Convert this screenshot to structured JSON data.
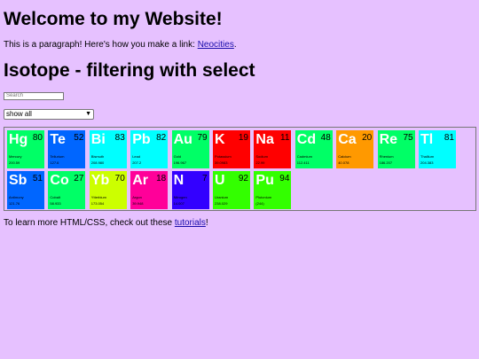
{
  "title": "Welcome to my Website!",
  "paragraph1": {
    "before": "This is a paragraph! Here's how you make a link: ",
    "link": "Neocities",
    "after": "."
  },
  "title2": "Isotope - filtering with select",
  "search": {
    "placeholder": "Search"
  },
  "filter": {
    "selected": "show all"
  },
  "elements": [
    {
      "symbol": "Hg",
      "number": "80",
      "name": "Mercury",
      "weight": "200.59",
      "color": "#00ff66"
    },
    {
      "symbol": "Te",
      "number": "52",
      "name": "Tellurium",
      "weight": "127.6",
      "color": "#0066ff"
    },
    {
      "symbol": "Bi",
      "number": "83",
      "name": "Bismuth",
      "weight": "208.980",
      "color": "#00ffff"
    },
    {
      "symbol": "Pb",
      "number": "82",
      "name": "Lead",
      "weight": "207.2",
      "color": "#00ffff"
    },
    {
      "symbol": "Au",
      "number": "79",
      "name": "Gold",
      "weight": "196.967",
      "color": "#00ff66"
    },
    {
      "symbol": "K",
      "number": "19",
      "name": "Potassium",
      "weight": "39.0983",
      "color": "#ff0000"
    },
    {
      "symbol": "Na",
      "number": "11",
      "name": "Sodium",
      "weight": "22.99",
      "color": "#ff0000"
    },
    {
      "symbol": "Cd",
      "number": "48",
      "name": "Cadmium",
      "weight": "112.411",
      "color": "#00ff66"
    },
    {
      "symbol": "Ca",
      "number": "20",
      "name": "Calcium",
      "weight": "40.078",
      "color": "#ff9900"
    },
    {
      "symbol": "Re",
      "number": "75",
      "name": "Rhenium",
      "weight": "186.207",
      "color": "#00ff66"
    },
    {
      "symbol": "Tl",
      "number": "81",
      "name": "Thallium",
      "weight": "204.383",
      "color": "#00ffff"
    },
    {
      "symbol": "Sb",
      "number": "51",
      "name": "Antimony",
      "weight": "121.76",
      "color": "#0066ff"
    },
    {
      "symbol": "Co",
      "number": "27",
      "name": "Cobalt",
      "weight": "58.933",
      "color": "#00ff66"
    },
    {
      "symbol": "Yb",
      "number": "70",
      "name": "Ytterbium",
      "weight": "173.054",
      "color": "#ccff00"
    },
    {
      "symbol": "Ar",
      "number": "18",
      "name": "Argon",
      "weight": "39.948",
      "color": "#ff0099"
    },
    {
      "symbol": "N",
      "number": "7",
      "name": "Nitrogen",
      "weight": "14.007",
      "color": "#3300ff"
    },
    {
      "symbol": "U",
      "number": "92",
      "name": "Uranium",
      "weight": "238.029",
      "color": "#33ff00"
    },
    {
      "symbol": "Pu",
      "number": "94",
      "name": "Plutonium",
      "weight": "(244)",
      "color": "#33ff00"
    }
  ],
  "paragraph2": {
    "before": "To learn more HTML/CSS, check out these ",
    "link": "tutorials",
    "after": "!"
  }
}
